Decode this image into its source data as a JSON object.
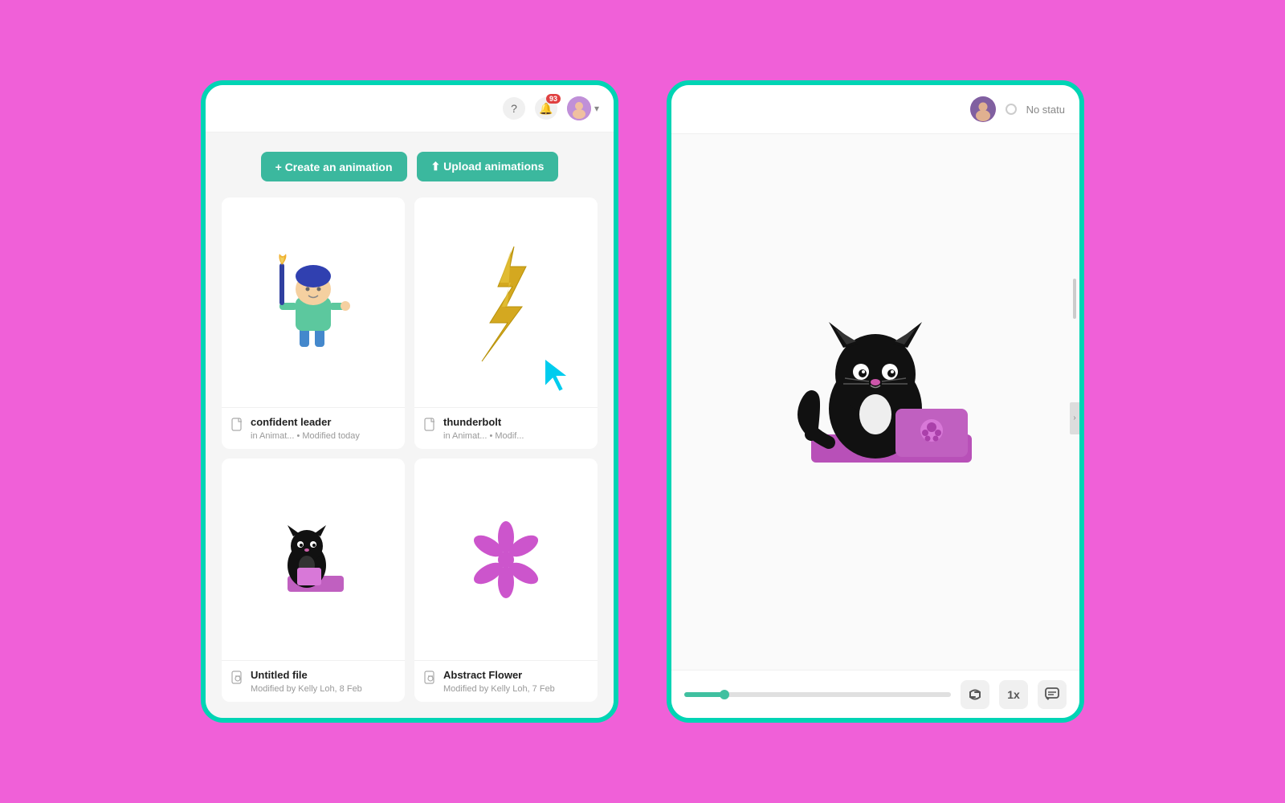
{
  "leftPanel": {
    "header": {
      "helpLabel": "?",
      "notifCount": "93",
      "chevron": "▾"
    },
    "actionBar": {
      "createLabel": "+ Create an animation",
      "uploadLabel": "⬆ Upload animations"
    },
    "cards": [
      {
        "id": "confident-leader",
        "title": "confident leader",
        "sub": "in Animat... • Modified today",
        "type": "character"
      },
      {
        "id": "thunderbolt",
        "title": "thunderbolt",
        "sub": "in Animat... • Modif...",
        "type": "lightning"
      },
      {
        "id": "untitled-file",
        "title": "Untitled file",
        "sub": "Modified by Kelly Loh, 8 Feb",
        "type": "cat-small"
      },
      {
        "id": "abstract-flower",
        "title": "Abstract Flower",
        "sub": "Modified by Kelly Loh, 7 Feb",
        "type": "flower"
      }
    ]
  },
  "rightPanel": {
    "header": {
      "statusLabel": "No statu"
    },
    "footer": {
      "progressPercent": 15,
      "speedLabel": "1x"
    }
  }
}
